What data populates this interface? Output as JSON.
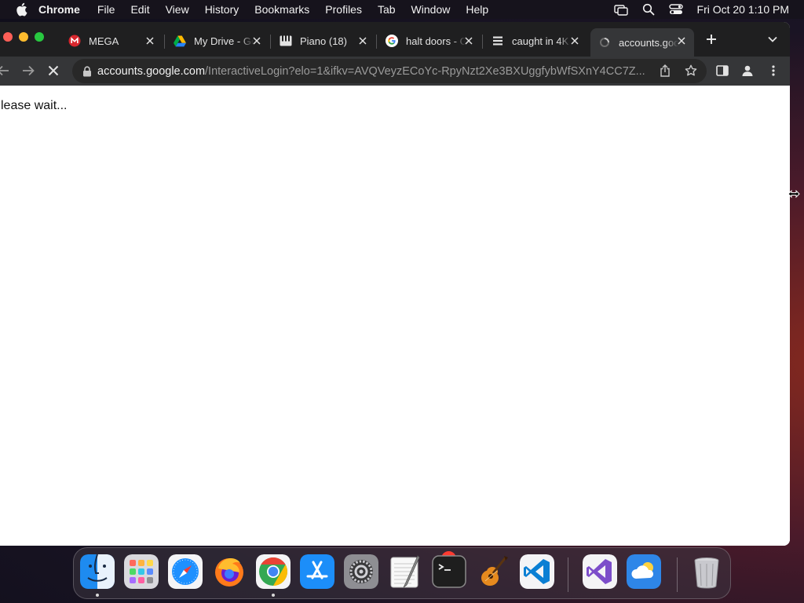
{
  "menubar": {
    "app_name": "Chrome",
    "items": [
      "File",
      "Edit",
      "View",
      "History",
      "Bookmarks",
      "Profiles",
      "Tab",
      "Window",
      "Help"
    ],
    "clock": "Fri Oct 20  1:10 PM"
  },
  "tabs": [
    {
      "title": "MEGA",
      "icon": "mega-icon",
      "active": false
    },
    {
      "title": "My Drive - Google Drive",
      "icon": "google-drive-icon",
      "active": false
    },
    {
      "title": "Piano (18)",
      "icon": "piano-icon",
      "active": false
    },
    {
      "title": "halt doors - Google Search",
      "icon": "google-icon",
      "active": false
    },
    {
      "title": "caught in 4K",
      "icon": "document-icon",
      "active": false
    },
    {
      "title": "accounts.google.com",
      "icon": "loading-icon",
      "active": true
    }
  ],
  "address_bar": {
    "host": "accounts.google.com",
    "path": "/InteractiveLogin?elo=1&ifkv=AVQVeyzECoYc-RpyNzt2Xe3BXUggfybWfSXnY4CC7Z..."
  },
  "page": {
    "message": "lease wait..."
  },
  "dock": {
    "apps": [
      "Finder",
      "Launchpad",
      "Safari",
      "Firefox",
      "Google Chrome",
      "App Store",
      "System Settings",
      "TextEdit",
      "Terminal",
      "GarageBand",
      "Visual Studio Code",
      "Visual Studio",
      "Weather",
      "Trash"
    ],
    "system_settings_badge": "1"
  },
  "colors": {
    "tabstrip": "#1f1f20",
    "toolbar": "#353638",
    "omnibox": "#282828",
    "page_background": "#ffffff"
  }
}
